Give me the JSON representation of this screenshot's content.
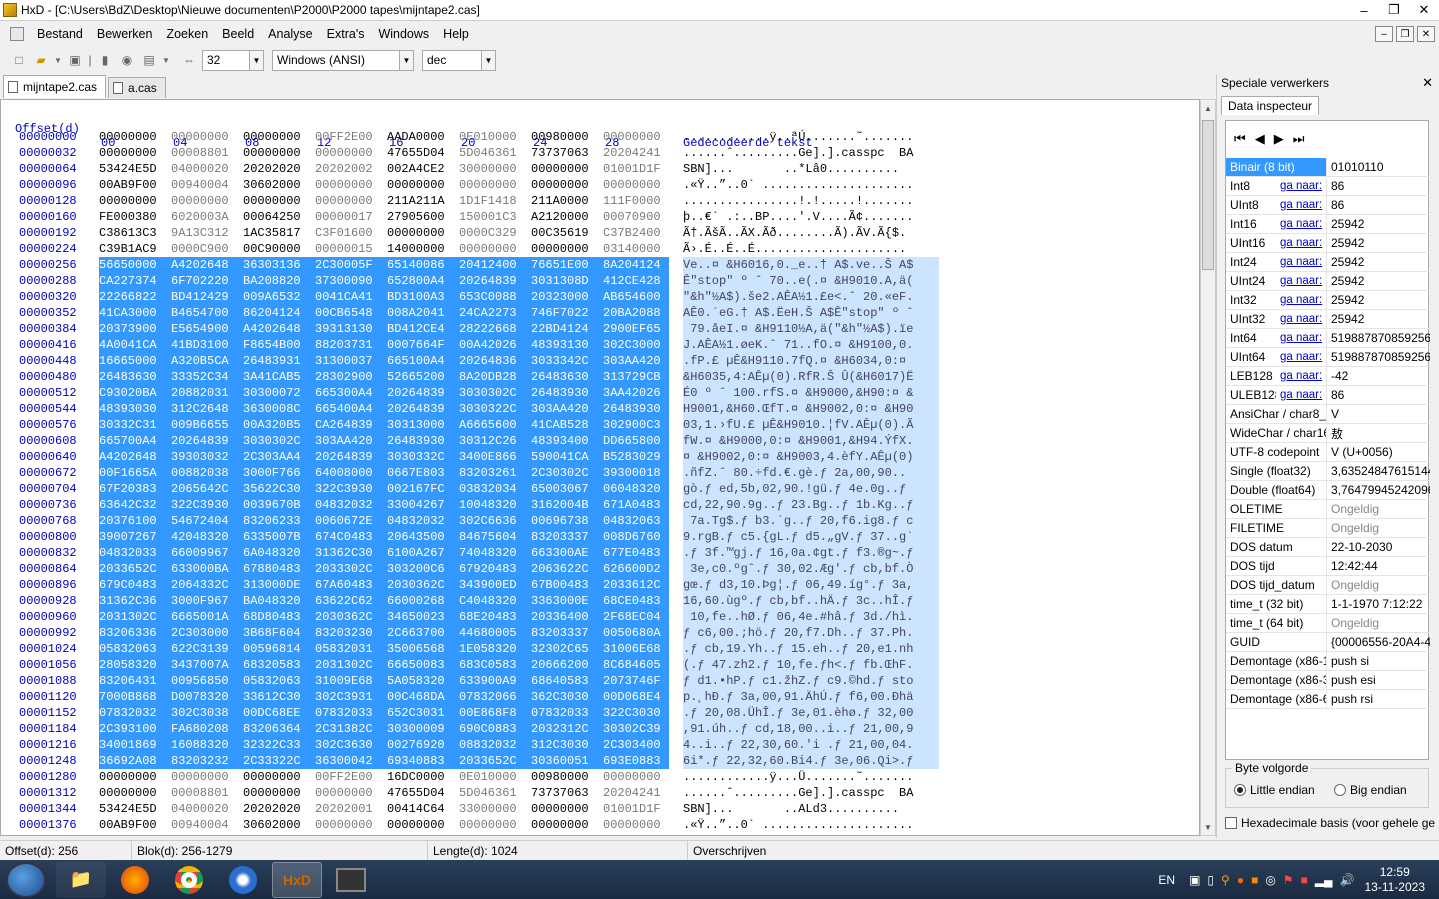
{
  "window": {
    "title": "HxD - [C:\\Users\\BdZ\\Desktop\\Nieuwe documenten\\P2000\\P2000 tapes\\mijntape2.cas]"
  },
  "menu": [
    "Bestand",
    "Bewerken",
    "Zoeken",
    "Beeld",
    "Analyse",
    "Extra's",
    "Windows",
    "Help"
  ],
  "toolbar": {
    "columns": "32",
    "charset": "Windows (ANSI)",
    "offset_base": "dec"
  },
  "tabs": [
    "mijntape2.cas",
    "a.cas"
  ],
  "hex_header": {
    "offset": "Offset(d)",
    "cols": [
      "00",
      "04",
      "08",
      "12",
      "16",
      "20",
      "24",
      "28"
    ],
    "text": "Gedecodeerde tekst"
  },
  "rows": [
    {
      "o": "00000000",
      "h": [
        "00000000",
        "00000000",
        "00000000",
        "00FF2E00",
        "AADA0000",
        "0E010000",
        "00980000",
        "00000000"
      ],
      "t": "............ÿ..ªÚ.......˜.......",
      "s": false
    },
    {
      "o": "00000032",
      "h": [
        "00000000",
        "00008801",
        "00000000",
        "00000000",
        "47655D04",
        "5D046361",
        "73737063",
        "20204241"
      ],
      "t": "......ˆ.........Ge].].casspc  BA",
      "s": false
    },
    {
      "o": "00000064",
      "h": [
        "53424E5D",
        "04000020",
        "20202020",
        "20202002",
        "002A4CE2",
        "30000000",
        "00000000",
        "01001D1F"
      ],
      "t": "SBN]...       ..*Lâ0..........",
      "s": false
    },
    {
      "o": "00000096",
      "h": [
        "00AB9F00",
        "00940004",
        "30602000",
        "00000000",
        "00000000",
        "00000000",
        "00000000",
        "00000000"
      ],
      "t": ".«Ÿ..”..0` .....................",
      "s": false
    },
    {
      "o": "00000128",
      "h": [
        "00000000",
        "00000000",
        "00000000",
        "00000000",
        "211A211A",
        "1D1F1418",
        "211A0000",
        "111F0000"
      ],
      "t": "................!.!.....!.......",
      "s": false
    },
    {
      "o": "00000160",
      "h": [
        "FE000380",
        "6020003A",
        "00064250",
        "00000017",
        "27905600",
        "150001C3",
        "A2120000",
        "00070900"
      ],
      "t": "þ..€` .:..BP....'.V....Ã¢.......",
      "s": false
    },
    {
      "o": "00000192",
      "h": [
        "C38613C3",
        "9A13C312",
        "1AC35817",
        "C3F01600",
        "00000000",
        "0000C329",
        "00C35619",
        "C37B2400"
      ],
      "t": "Ã†.ÃšÃ..ÃX.Ãð........Ã).ÃV.Ã{$.",
      "s": false
    },
    {
      "o": "00000224",
      "h": [
        "C39B1AC9",
        "0000C900",
        "00C90000",
        "00000015",
        "14000000",
        "00000000",
        "00000000",
        "03140000"
      ],
      "t": "Ã›.É..É..É.....................",
      "s": false
    },
    {
      "o": "00000256",
      "h": [
        "56650000",
        "A4202648",
        "36303136",
        "2C30005F",
        "65140086",
        "20412400",
        "76651E00",
        "8A204124"
      ],
      "t": "Ve..¤ &H6016,0._e..† A$.ve..Š A$",
      "s": true
    },
    {
      "o": "00000288",
      "h": [
        "CA227374",
        "6F702220",
        "BA208820",
        "37300090",
        "652800A4",
        "20264839",
        "3031308D",
        "412CE428"
      ],
      "t": "Ê\"stop\" º ˆ 70..e(.¤ &H9010.A,ä(",
      "s": true
    },
    {
      "o": "00000320",
      "h": [
        "22266822",
        "BD412429",
        "009A6532",
        "0041CA41",
        "BD3100A3",
        "653C0088",
        "20323000",
        "AB654600"
      ],
      "t": "\"&h\"½A$).še2.AÊA½1.£e<.ˆ 20.«eF.",
      "s": true
    },
    {
      "o": "00000352",
      "h": [
        "41CA3000",
        "B4654700",
        "86204124",
        "00CB6548",
        "008A2041",
        "24CA2273",
        "746F7022",
        "20BA2088"
      ],
      "t": "AÊ0.´eG.† A$.ËeH.Š A$Ê\"stop\" º ˆ",
      "s": true
    },
    {
      "o": "00000384",
      "h": [
        "20373900",
        "E5654900",
        "A4202648",
        "39313130",
        "BD412CE4",
        "28222668",
        "22BD4124",
        "2900EF65"
      ],
      "t": " 79.åeI.¤ &H9110½A,ä(\"&h\"½A$).ïe",
      "s": true
    },
    {
      "o": "00000416",
      "h": [
        "4A0041CA",
        "41BD3100",
        "F8654B00",
        "88203731",
        "0007664F",
        "00A42026",
        "48393130",
        "302C3000"
      ],
      "t": "J.AÊA½1.øeK.ˆ 71..fO.¤ &H9100,0.",
      "s": true
    },
    {
      "o": "00000448",
      "h": [
        "16665000",
        "A320B5CA",
        "26483931",
        "31300037",
        "665100A4",
        "20264836",
        "3033342C",
        "303AA420"
      ],
      "t": ".fP.£ µÊ&H9110.7fQ.¤ &H6034,0:¤ ",
      "s": true
    },
    {
      "o": "00000480",
      "h": [
        "26483630",
        "33352C34",
        "3A41CAB5",
        "28302900",
        "52665200",
        "8A20DB28",
        "26483630",
        "313729CB"
      ],
      "t": "&H6035,4:AÊµ(0).RfR.Š Û(&H6017)Ë",
      "s": true
    },
    {
      "o": "00000512",
      "h": [
        "C93020BA",
        "20882031",
        "30300072",
        "665300A4",
        "20264839",
        "3030302C",
        "26483930",
        "3AA42026"
      ],
      "t": "É0 º ˆ 100.rfS.¤ &H9000,&H90:¤ &",
      "s": true
    },
    {
      "o": "00000544",
      "h": [
        "48393030",
        "312C2648",
        "3630008C",
        "665400A4",
        "20264839",
        "3030322C",
        "303AA420",
        "26483930"
      ],
      "t": "H9001,&H60.ŒfT.¤ &H9002,0:¤ &H90",
      "s": true
    },
    {
      "o": "00000576",
      "h": [
        "30332C31",
        "009B6655",
        "00A320B5",
        "CA264839",
        "30313000",
        "A6665600",
        "41CAB528",
        "302900C3"
      ],
      "t": "03,1.›fU.£ µÊ&H9010.¦fV.AÊµ(0).Ã",
      "s": true
    },
    {
      "o": "00000608",
      "h": [
        "665700A4",
        "20264839",
        "3030302C",
        "303AA420",
        "26483930",
        "30312C26",
        "48393400",
        "DD665800"
      ],
      "t": "fW.¤ &H9000,0:¤ &H9001,&H94.ÝfX.",
      "s": true
    },
    {
      "o": "00000640",
      "h": [
        "A4202648",
        "39303032",
        "2C303AA4",
        "20264839",
        "3030332C",
        "3400E866",
        "590041CA",
        "B5283029"
      ],
      "t": "¤ &H9002,0:¤ &H9003,4.èfY.AÊµ(0)",
      "s": true
    },
    {
      "o": "00000672",
      "h": [
        "00F1665A",
        "00882038",
        "3000F766",
        "64008000",
        "0667E803",
        "83203261",
        "2C30302C",
        "39300018"
      ],
      "t": ".ñfZ.ˆ 80.÷fd.€.gè.ƒ 2a,00,90..",
      "s": true
    },
    {
      "o": "00000704",
      "h": [
        "67F20383",
        "2065642C",
        "35622C30",
        "322C3930",
        "002167FC",
        "03832034",
        "65003067",
        "06048320"
      ],
      "t": "gò.ƒ ed,5b,02,90.!gü.ƒ 4e.0g..ƒ ",
      "s": true
    },
    {
      "o": "00000736",
      "h": [
        "63642C32",
        "322C3930",
        "0039670B",
        "04832032",
        "33004267",
        "10048320",
        "3162004B",
        "671A0483"
      ],
      "t": "cd,22,90.9g..ƒ 23.Bg..ƒ 1b.Kg..ƒ",
      "s": true
    },
    {
      "o": "00000768",
      "h": [
        "20376100",
        "54672404",
        "83206233",
        "0060672E",
        "04832032",
        "302C6636",
        "00696738",
        "04832063"
      ],
      "t": " 7a.Tg$.ƒ b3.`g..ƒ 20,f6.ig8.ƒ c",
      "s": true
    },
    {
      "o": "00000800",
      "h": [
        "39007267",
        "42048320",
        "6335007B",
        "674C0483",
        "20643500",
        "84675604",
        "83203337",
        "008D6760"
      ],
      "t": "9.rgB.ƒ c5.{gL.ƒ d5.„gV.ƒ 37..g`",
      "s": true
    },
    {
      "o": "00000832",
      "h": [
        "04832033",
        "66009967",
        "6A048320",
        "31362C30",
        "6100A267",
        "74048320",
        "663300AE",
        "677E0483"
      ],
      "t": ".ƒ 3f.™gj.ƒ 16,0a.¢gt.ƒ f3.®g~.ƒ",
      "s": true
    },
    {
      "o": "00000864",
      "h": [
        "2033652C",
        "633000BA",
        "67880483",
        "2033302C",
        "303200C6",
        "67920483",
        "2063622C",
        "626600D2"
      ],
      "t": " 3e,c0.ºgˆ.ƒ 30,02.Æg'.ƒ cb,bf.Ò",
      "s": true
    },
    {
      "o": "00000896",
      "h": [
        "679C0483",
        "2064332C",
        "313000DE",
        "67A60483",
        "2030362C",
        "343900ED",
        "67B00483",
        "2033612C"
      ],
      "t": "gœ.ƒ d3,10.Þg¦.ƒ 06,49.íg°.ƒ 3a,",
      "s": true
    },
    {
      "o": "00000928",
      "h": [
        "31362C36",
        "3000F967",
        "BA048320",
        "63622C62",
        "66000268",
        "C4048320",
        "3363000E",
        "68CE0483"
      ],
      "t": "16,60.ùgº.ƒ cb,bf..hÄ.ƒ 3c..hÎ.ƒ",
      "s": true
    },
    {
      "o": "00000960",
      "h": [
        "2031302C",
        "6665001A",
        "68D80483",
        "2030362C",
        "34650023",
        "68E20483",
        "20336400",
        "2F68EC04"
      ],
      "t": " 10,fe..hØ.ƒ 06,4e.#hâ.ƒ 3d./hì.",
      "s": true
    },
    {
      "o": "00000992",
      "h": [
        "83206336",
        "2C303000",
        "3B68F604",
        "83203230",
        "2C663700",
        "44680005",
        "83203337",
        "0050680A"
      ],
      "t": "ƒ c6,00.;hö.ƒ 20,f7.Dh..ƒ 37.Ph.",
      "s": true
    },
    {
      "o": "00001024",
      "h": [
        "05832063",
        "622C3139",
        "00596814",
        "05832031",
        "35006568",
        "1E058320",
        "32302C65",
        "31006E68"
      ],
      "t": ".ƒ cb,19.Yh..ƒ 15.eh..ƒ 20,e1.nh",
      "s": true
    },
    {
      "o": "00001056",
      "h": [
        "28058320",
        "3437007A",
        "68320583",
        "2031302C",
        "66650083",
        "683C0583",
        "20666200",
        "8C684605"
      ],
      "t": "(.ƒ 47.zh2.ƒ 10,fe.ƒh<.ƒ fb.ŒhF.",
      "s": true
    },
    {
      "o": "00001088",
      "h": [
        "83206431",
        "00956850",
        "05832063",
        "31009E68",
        "5A058320",
        "633900A9",
        "68640583",
        "2073746F"
      ],
      "t": "ƒ d1.•hP.ƒ c1.žhZ.ƒ c9.©hd.ƒ sto",
      "s": true
    },
    {
      "o": "00001120",
      "h": [
        "7000B868",
        "D0078320",
        "33612C30",
        "302C3931",
        "00C468DA",
        "07832066",
        "362C3030",
        "00D068E4"
      ],
      "t": "p.¸hÐ.ƒ 3a,00,91.ÄhÚ.ƒ f6,00.Ðhä",
      "s": true
    },
    {
      "o": "00001152",
      "h": [
        "07832032",
        "302C3038",
        "00DC68EE",
        "07832033",
        "652C3031",
        "00E868F8",
        "07832033",
        "322C3030"
      ],
      "t": ".ƒ 20,08.ÜhÎ.ƒ 3e,01.èhø.ƒ 32,00",
      "s": true
    },
    {
      "o": "00001184",
      "h": [
        "2C393100",
        "FA680208",
        "83206364",
        "2C31382C",
        "30300009",
        "690C0883",
        "2032312C",
        "30302C39"
      ],
      "t": ",91.úh..ƒ cd,18,00..i..ƒ 21,00,9",
      "s": true
    },
    {
      "o": "00001216",
      "h": [
        "34001869",
        "16088320",
        "32322C33",
        "302C3630",
        "00276920",
        "08832032",
        "312C3030",
        "2C303400"
      ],
      "t": "4..i..ƒ 22,30,60.'i .ƒ 21,00,04.",
      "s": true
    },
    {
      "o": "00001248",
      "h": [
        "36692A08",
        "83203232",
        "2C33322C",
        "36300042",
        "69340883",
        "2033652C",
        "30360051",
        "693E0883"
      ],
      "t": "6i*.ƒ 22,32,60.Bi4.ƒ 3e,06.Qi>.ƒ",
      "s": true
    },
    {
      "o": "00001280",
      "h": [
        "00000000",
        "00000000",
        "00000000",
        "00FF2E00",
        "16DC0000",
        "0E010000",
        "00980000",
        "00000000"
      ],
      "t": "............ÿ...Ü.......˜.......",
      "s": false
    },
    {
      "o": "00001312",
      "h": [
        "00000000",
        "00008801",
        "00000000",
        "00000000",
        "47655D04",
        "5D046361",
        "73737063",
        "20204241"
      ],
      "t": "......ˆ.........Ge].].casspc  BA",
      "s": false
    },
    {
      "o": "00001344",
      "h": [
        "53424E5D",
        "04000020",
        "20202020",
        "20202001",
        "00414C64",
        "33000000",
        "00000000",
        "01001D1F"
      ],
      "t": "SBN]...       ..ALd3..........",
      "s": false
    },
    {
      "o": "00001376",
      "h": [
        "00AB9F00",
        "00940004",
        "30602000",
        "00000000",
        "00000000",
        "00000000",
        "00000000",
        "00000000"
      ],
      "t": ".«Ÿ..”..0` .....................",
      "s": false
    }
  ],
  "panel": {
    "title": "Speciale verwerkers",
    "tab": "Data inspecteur",
    "goto": "ga naar:",
    "items": [
      {
        "n": "Binair (8 bit)",
        "v": "01010110",
        "link": false,
        "sel": true
      },
      {
        "n": "Int8",
        "v": "86",
        "link": true
      },
      {
        "n": "UInt8",
        "v": "86",
        "link": true
      },
      {
        "n": "Int16",
        "v": "25942",
        "link": true
      },
      {
        "n": "UInt16",
        "v": "25942",
        "link": true
      },
      {
        "n": "Int24",
        "v": "25942",
        "link": true
      },
      {
        "n": "UInt24",
        "v": "25942",
        "link": true
      },
      {
        "n": "Int32",
        "v": "25942",
        "link": true
      },
      {
        "n": "UInt32",
        "v": "25942",
        "link": true
      },
      {
        "n": "Int64",
        "v": "5198878708592567",
        "link": true
      },
      {
        "n": "UInt64",
        "v": "5198878708592567",
        "link": true
      },
      {
        "n": "LEB128",
        "v": "-42",
        "link": true
      },
      {
        "n": "ULEB128",
        "v": "86",
        "link": true
      },
      {
        "n": "AnsiChar / char8_t",
        "v": "V",
        "link": false
      },
      {
        "n": "WideChar / char16",
        "v": "敖",
        "link": false
      },
      {
        "n": "UTF-8 codepoint",
        "v": "V (U+0056)",
        "link": false
      },
      {
        "n": "Single (float32)",
        "v": "3,63524847615144E",
        "link": false
      },
      {
        "n": "Double (float64)",
        "v": "3,76479945242096E",
        "link": false
      },
      {
        "n": "OLETIME",
        "v": "Ongeldig",
        "link": false,
        "grey": true
      },
      {
        "n": "FILETIME",
        "v": "Ongeldig",
        "link": false,
        "grey": true
      },
      {
        "n": "DOS datum",
        "v": "22-10-2030",
        "link": false
      },
      {
        "n": "DOS tijd",
        "v": "12:42:44",
        "link": false
      },
      {
        "n": "DOS tijd_datum",
        "v": "Ongeldig",
        "link": false,
        "grey": true
      },
      {
        "n": "time_t (32 bit)",
        "v": "1-1-1970 7:12:22",
        "link": false
      },
      {
        "n": "time_t (64 bit)",
        "v": "Ongeldig",
        "link": false,
        "grey": true
      },
      {
        "n": "GUID",
        "v": "{00006556-20A4-48",
        "link": false
      },
      {
        "n": "Demontage (x86-16)",
        "v": "push si",
        "link": false
      },
      {
        "n": "Demontage (x86-32)",
        "v": "push esi",
        "link": false
      },
      {
        "n": "Demontage (x86-64)",
        "v": "push rsi",
        "link": false
      }
    ],
    "byte_order_label": "Byte volgorde",
    "little": "Little endian",
    "big": "Big endian",
    "hexbase": "Hexadecimale basis (voor gehele ge"
  },
  "status": {
    "offset": "Offset(d): 256",
    "block": "Blok(d): 256-1279",
    "length": "Lengte(d): 1024",
    "mode": "Overschrijven"
  },
  "tray": {
    "lang": "EN",
    "time": "12:59",
    "date": "13-11-2023"
  }
}
